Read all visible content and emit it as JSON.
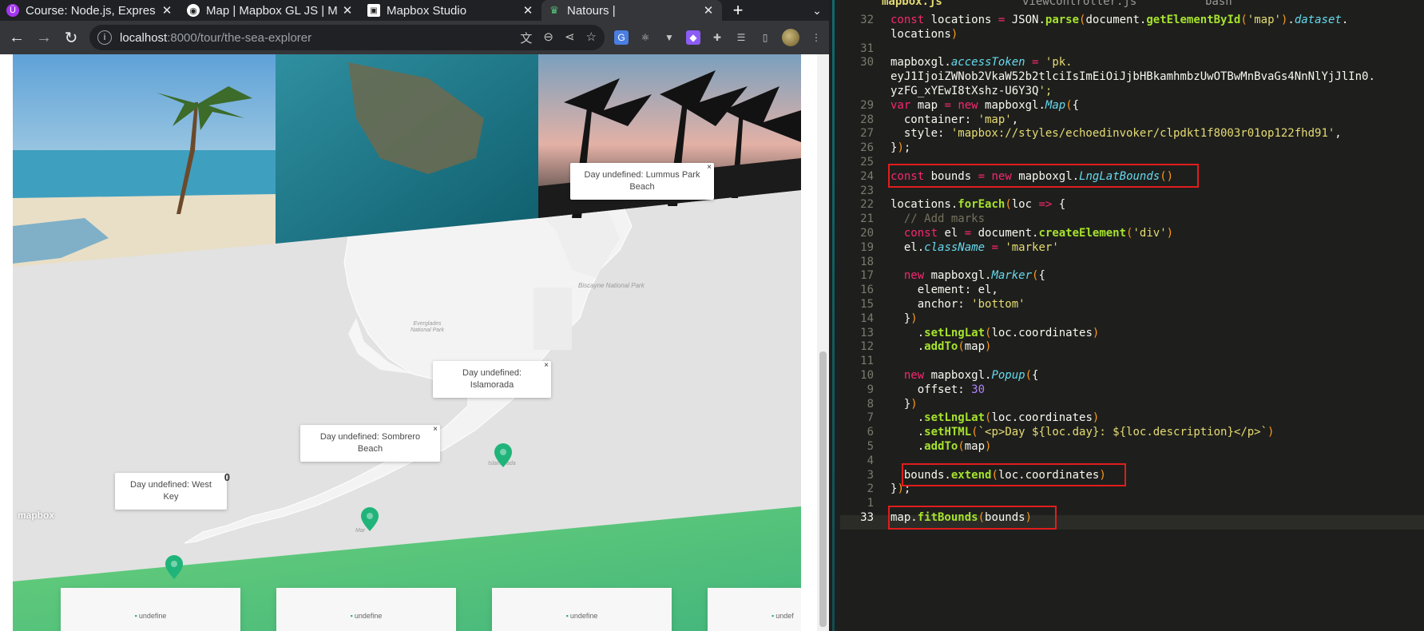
{
  "browser": {
    "tabs": [
      {
        "title": "Course: Node.js, Expres",
        "icon": "udemy-icon",
        "color": "#a435f0",
        "active": false
      },
      {
        "title": "Map | Mapbox GL JS | M",
        "icon": "mapbox-icon",
        "color": "#ffffff",
        "active": false
      },
      {
        "title": "Mapbox Studio",
        "icon": "mapbox-studio-icon",
        "color": "#ffffff",
        "active": false
      },
      {
        "title": "Natours |",
        "icon": "natours-icon",
        "color": "#55c57a",
        "active": true
      }
    ],
    "new_tab": "+",
    "url_host": "localhost",
    "url_rest": ":8000/tour/the-sea-explorer"
  },
  "page": {
    "popups": [
      {
        "text": "Day undefined: Lummus Park Beach",
        "close": "×"
      },
      {
        "text": "Day undefined: Islamorada",
        "close": "×"
      },
      {
        "text": "Day undefined: Sombrero Beach",
        "close": "×"
      },
      {
        "text": "Day undefined: West Key",
        "close": "0"
      }
    ],
    "map_labels": {
      "biscayne": "Biscayne National Park",
      "everglades": "Everglades National Park",
      "islamorada": "Islamorada",
      "marathon": "Mar"
    },
    "mapbox_logo": "mapbox",
    "cards": [
      {
        "alt": "undefine"
      },
      {
        "alt": "undefine"
      },
      {
        "alt": "undefine"
      },
      {
        "alt": "undef"
      }
    ],
    "brand_color": "#55c57a"
  },
  "editor": {
    "tabs": [
      {
        "label": "mapbox.js",
        "active": true
      },
      {
        "label": "viewController.js",
        "active": false
      },
      {
        "label": "bash",
        "active": false
      }
    ],
    "line_numbers": [
      "32",
      "",
      "31",
      "30",
      "",
      "",
      "29",
      "28",
      "27",
      "26",
      "25",
      "24",
      "23",
      "22",
      "21",
      "20",
      "19",
      "18",
      "17",
      "16",
      "15",
      "14",
      "13",
      "12",
      "11",
      "10",
      "9",
      "8",
      "7",
      "6",
      "5",
      "4",
      "3",
      "2",
      "1",
      "33"
    ],
    "code_lines": [
      "const locations = JSON.parse(document.getElementById('map').dataset.",
      "locations)",
      "",
      "mapboxgl.accessToken = 'pk.",
      "eyJ1IjoiZWNob2VkaW52b2tlciIsImEiOiJjbHBkamhmbzUwOTBwMnBvaGs4NnNlYjJlIn0.",
      "yzFG_xYEwI8tXshz-U6Y3Q';",
      "var map = new mapboxgl.Map({",
      "  container: 'map',",
      "  style: 'mapbox://styles/echoedinvoker/clpdkt1f8003r01op122fhd91',",
      "});",
      "",
      "const bounds = new mapboxgl.LngLatBounds()",
      "",
      "locations.forEach(loc => {",
      "  // Add marks",
      "  const el = document.createElement('div')",
      "  el.className = 'marker'",
      "",
      "  new mapboxgl.Marker({",
      "    element: el,",
      "    anchor: 'bottom'",
      "  })",
      "    .setLngLat(loc.coordinates)",
      "    .addTo(map)",
      "",
      "  new mapboxgl.Popup({",
      "    offset: 30",
      "  })",
      "    .setLngLat(loc.coordinates)",
      "    .setHTML(`<p>Day ${loc.day}: ${loc.description}</p>`)",
      "    .addTo(map)",
      "",
      "  bounds.extend(loc.coordinates)",
      "});",
      "",
      "map.fitBounds(bounds)"
    ],
    "current_line": "33"
  }
}
